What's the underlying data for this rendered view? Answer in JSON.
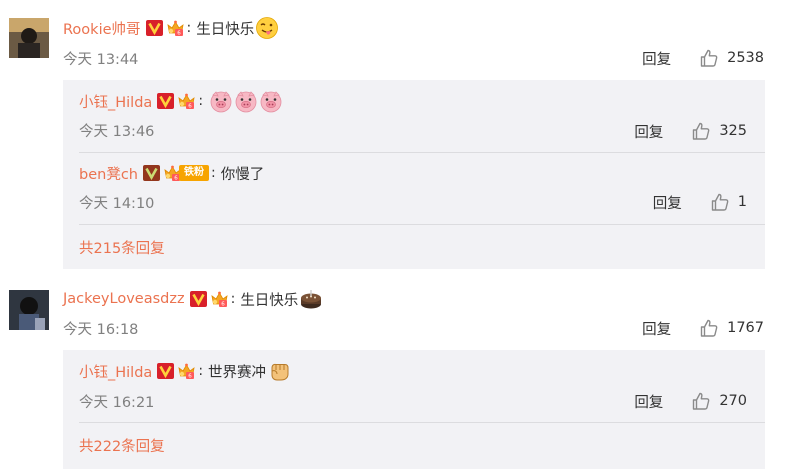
{
  "colors": {
    "username": "#eb7350",
    "meta": "#808080",
    "subbox_bg": "#f2f2f5",
    "vip_badge": "#f0a020"
  },
  "icons": {
    "verified": "v-badge-icon",
    "member": "crown-member-icon",
    "like": "thumbs-up-icon",
    "pig": "pig-face-emoji",
    "tongue": "tongue-out-emoji",
    "cake": "cake-emoji",
    "fist": "fist-emoji"
  },
  "comments": [
    {
      "user": "Rookie帅哥",
      "text": "生日快乐",
      "time": "今天 13:44",
      "reply_label": "回复",
      "likes": "2538",
      "replies": [
        {
          "user": "小钰_Hilda",
          "text": "",
          "time": "今天 13:46",
          "reply_label": "回复",
          "likes": "325"
        },
        {
          "user": "ben凳ch",
          "fan_badge": "铁粉",
          "text": "你慢了",
          "time": "今天 14:10",
          "reply_label": "回复",
          "likes": "1"
        }
      ],
      "more_label": "共215条回复"
    },
    {
      "user": "JackeyLoveasdzz",
      "text": "生日快乐",
      "time": "今天 16:18",
      "reply_label": "回复",
      "likes": "1767",
      "replies": [
        {
          "user": "小钰_Hilda",
          "text": "世界赛冲",
          "time": "今天 16:21",
          "reply_label": "回复",
          "likes": "270"
        }
      ],
      "more_label": "共222条回复"
    }
  ]
}
